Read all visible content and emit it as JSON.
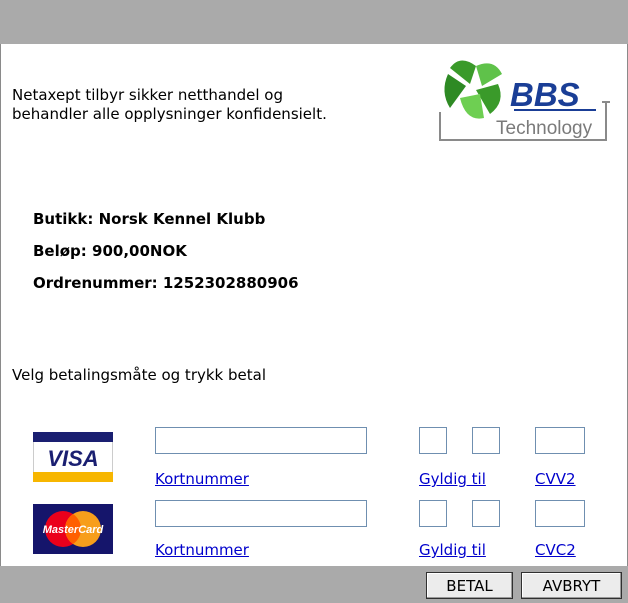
{
  "header": {
    "intro_line1": "Netaxept tilbyr sikker netthandel og",
    "intro_line2": "behandler alle opplysninger konfidensielt."
  },
  "logo": {
    "brand": "BBS",
    "subtitle": "Technology"
  },
  "order": {
    "shop": "Butikk: Norsk Kennel Klubb",
    "amount": "Beløp: 900,00NOK",
    "order_no": "Ordrenummer: 1252302880906"
  },
  "instruction": "Velg betalingsmåte og trykk betal",
  "cards": [
    {
      "name": "VISA",
      "card_number_label": "Kortnummer",
      "valid_label": "Gyldig til",
      "code_label": "CVV2"
    },
    {
      "name": "MasterCard",
      "card_number_label": "Kortnummer",
      "valid_label": "Gyldig til",
      "code_label": "CVC2"
    }
  ],
  "buttons": {
    "pay": "BETAL",
    "cancel": "AVBRYT"
  },
  "colors": {
    "bar": "#aaaaaa",
    "link": "#0000cc",
    "visa_blue": "#1a1f71",
    "visa_gold": "#f7b600",
    "mc_red": "#eb001b",
    "mc_yellow": "#f79e1b",
    "bbs_green": "#3a9a2a",
    "bbs_blue": "#1a3e96"
  }
}
